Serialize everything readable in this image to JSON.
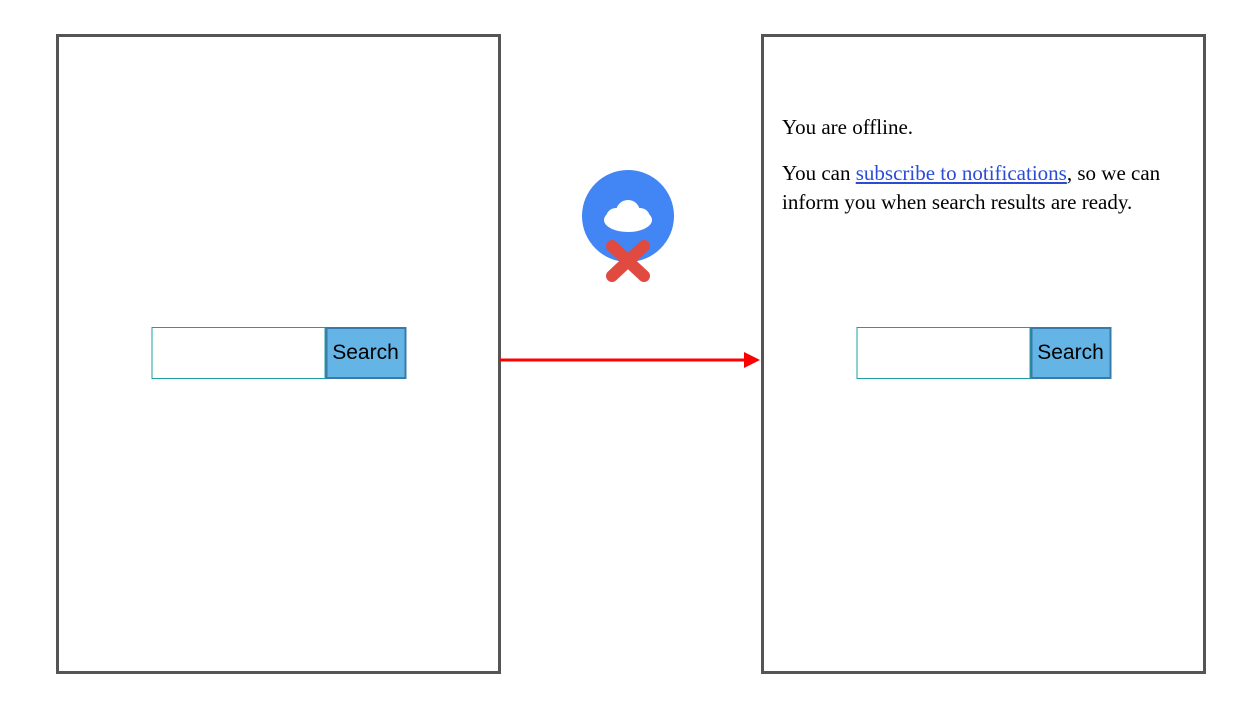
{
  "left": {
    "search_input_value": "",
    "search_button_label": "Search"
  },
  "right": {
    "offline_line1": "You are offline.",
    "offline_line2_prefix": "You can ",
    "offline_line2_link": "subscribe to notifications",
    "offline_line2_suffix": ", so we can inform you when search results are ready.",
    "search_input_value": "",
    "search_button_label": "Search"
  },
  "icons": {
    "offline_icon": "cloud-offline-icon",
    "arrow_icon": "arrow-right-icon"
  },
  "colors": {
    "panel_border": "#555555",
    "input_border": "#1aa0a0",
    "button_bg": "#64b4e5",
    "button_border": "#3a7aa8",
    "link": "#2a4cd7",
    "arrow": "#ff0000",
    "cloud_badge": "#4285f4",
    "x_mark": "#e04a3f"
  }
}
